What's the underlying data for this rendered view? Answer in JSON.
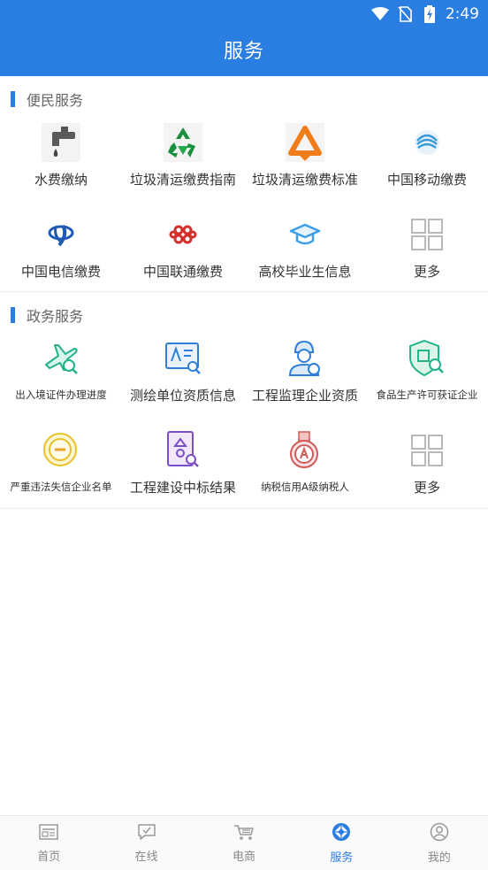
{
  "status": {
    "time": "2:49",
    "icons": [
      "wifi-icon",
      "no-sim-icon",
      "battery-charging-icon"
    ]
  },
  "header": {
    "title": "服务"
  },
  "sections": [
    {
      "title": "便民服务",
      "items": [
        {
          "label": "水费缴纳",
          "icon": "faucet-icon"
        },
        {
          "label": "垃圾清运缴费指南",
          "icon": "recycle-icon"
        },
        {
          "label": "垃圾清运缴费标准",
          "icon": "recycle-triangle-icon"
        },
        {
          "label": "中国移动缴费",
          "icon": "china-mobile-icon"
        },
        {
          "label": "中国电信缴费",
          "icon": "china-telecom-icon"
        },
        {
          "label": "中国联通缴费",
          "icon": "china-unicom-icon"
        },
        {
          "label": "高校毕业生信息",
          "icon": "graduation-cap-icon"
        },
        {
          "label": "更多",
          "icon": "grid-more-icon"
        }
      ]
    },
    {
      "title": "政务服务",
      "items": [
        {
          "label": "出入境证件办理进度",
          "icon": "airplane-search-icon"
        },
        {
          "label": "测绘单位资质信息",
          "icon": "certificate-search-icon"
        },
        {
          "label": "工程监理企业资质",
          "icon": "engineer-helmet-icon"
        },
        {
          "label": "食品生产许可获证企业",
          "icon": "food-shield-icon"
        },
        {
          "label": "严重违法失信企业名单",
          "icon": "violation-badge-icon"
        },
        {
          "label": "工程建设中标结果",
          "icon": "tender-document-icon"
        },
        {
          "label": "纳税信用A级纳税人",
          "icon": "medal-a-icon"
        },
        {
          "label": "更多",
          "icon": "grid-more-icon"
        }
      ]
    }
  ],
  "bottom_nav": [
    {
      "label": "首页",
      "icon": "home-news-icon",
      "active": false
    },
    {
      "label": "在线",
      "icon": "chat-check-icon",
      "active": false
    },
    {
      "label": "电商",
      "icon": "shopping-cart-icon",
      "active": false
    },
    {
      "label": "服务",
      "icon": "service-diamond-icon",
      "active": true
    },
    {
      "label": "我的",
      "icon": "user-profile-icon",
      "active": false
    }
  ],
  "colors": {
    "accent": "#2a7de1",
    "header_bg": "#2a7de1"
  }
}
